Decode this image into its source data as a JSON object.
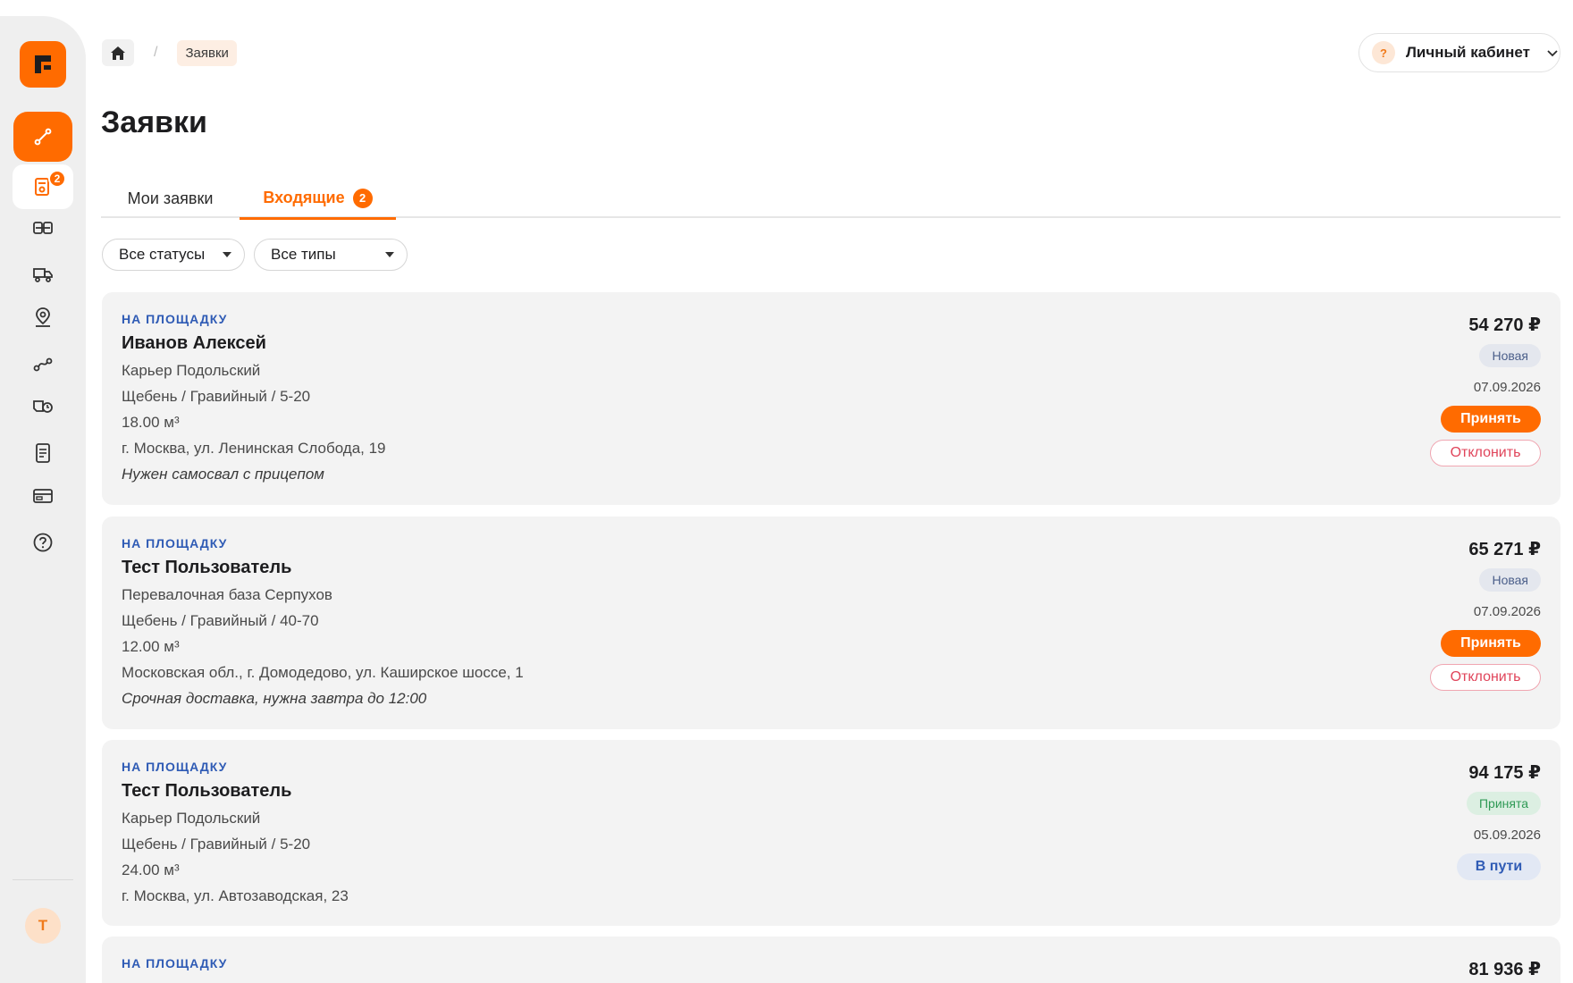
{
  "breadcrumb": {
    "home_icon": "home-icon",
    "current": "Заявки"
  },
  "header": {
    "cabinet_label": "Личный кабинет",
    "cabinet_help": "?"
  },
  "page": {
    "title": "Заявки"
  },
  "tabs": [
    {
      "label": "Мои заявки",
      "active": false
    },
    {
      "label": "Входящие",
      "active": true,
      "count": "2"
    }
  ],
  "filters": {
    "status": "Все статусы",
    "type": "Все типы"
  },
  "sidebar": {
    "nav_badge": "2",
    "avatar": "Т",
    "icons": [
      "route-icon",
      "orders-icon",
      "contracts-icon",
      "trucks-icon",
      "location-pin-icon",
      "routes-icon",
      "fleet-clock-icon",
      "documents-icon",
      "payment-card-icon",
      "help-icon"
    ]
  },
  "colors": {
    "accent": "#ff6b00",
    "kind": "#2f5bb5",
    "new_status": "#4b5f8a",
    "accepted_status": "#2f9a55",
    "reject": "#e0445a"
  },
  "cards": [
    {
      "kind": "НА ПЛОЩАДКУ",
      "name": "Иванов Алексей",
      "source": "Карьер Подольский",
      "material": "Щебень / Гравийный / 5-20",
      "volume": "18.00 м³",
      "address": "г. Москва, ул. Ленинская Слобода, 19",
      "comment": "Нужен самосвал с прицепом",
      "price": "54 270 ₽",
      "status": "Новая",
      "date": "07.09.2026",
      "accept_label": "Принять",
      "reject_label": "Отклонить"
    },
    {
      "kind": "НА ПЛОЩАДКУ",
      "name": "Тест Пользователь",
      "source": "Перевалочная база Серпухов",
      "material": "Щебень / Гравийный / 40-70",
      "volume": "12.00 м³",
      "address": "Московская обл., г. Домодедово, ул. Каширское шоссе, 1",
      "comment": "Срочная доставка, нужна завтра до 12:00",
      "price": "65 271 ₽",
      "status": "Новая",
      "date": "07.09.2026",
      "accept_label": "Принять",
      "reject_label": "Отклонить"
    },
    {
      "kind": "НА ПЛОЩАДКУ",
      "name": "Тест Пользователь",
      "source": "Карьер Подольский",
      "material": "Щебень / Гравийный / 5-20",
      "volume": "24.00 м³",
      "address": "г. Москва, ул. Автозаводская, 23",
      "price": "94 175 ₽",
      "status": "Принята",
      "date": "05.09.2026",
      "transit_label": "В пути"
    },
    {
      "kind": "НА ПЛОЩАДКУ",
      "price": "81 936 ₽"
    }
  ]
}
